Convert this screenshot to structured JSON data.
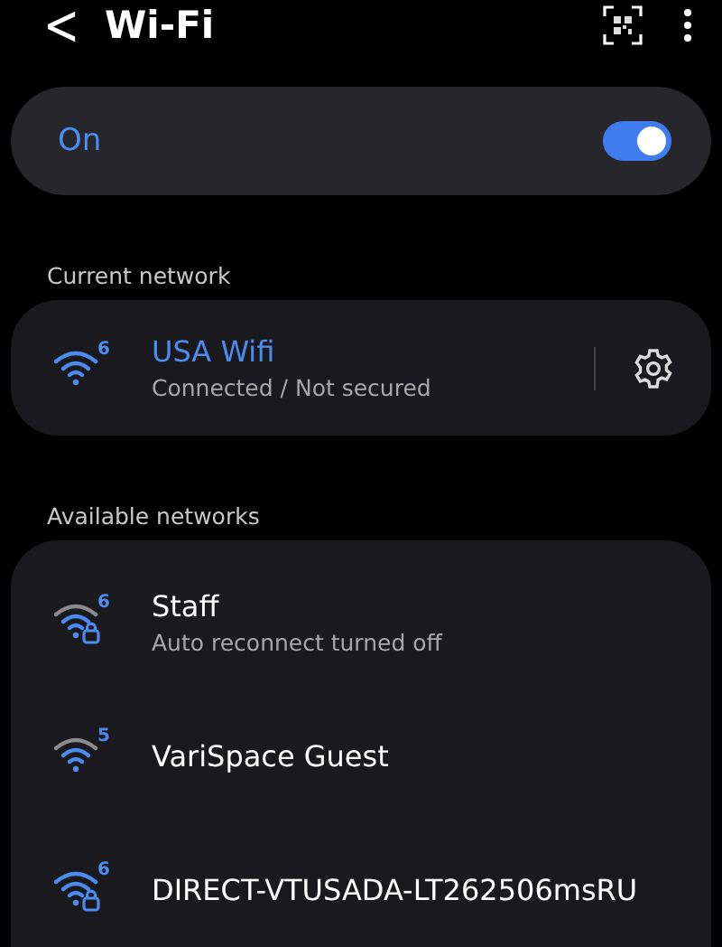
{
  "header": {
    "back": "<",
    "title": "Wi-Fi"
  },
  "master": {
    "label": "On",
    "on": true
  },
  "current": {
    "heading": "Current network",
    "network": {
      "name": "USA Wifi",
      "status": "Connected / Not secured",
      "band": "6",
      "locked": false,
      "kind": "full"
    }
  },
  "available": {
    "heading": "Available networks",
    "networks": [
      {
        "name": "Staff",
        "status": "Auto reconnect turned off",
        "band": "6",
        "locked": true,
        "kind": "partial"
      },
      {
        "name": "VariSpace Guest",
        "band": "5",
        "locked": false,
        "kind": "partial"
      },
      {
        "name": "DIRECT-VTUSADA-LT262506msRU",
        "band": "6",
        "locked": true,
        "kind": "full"
      }
    ]
  }
}
